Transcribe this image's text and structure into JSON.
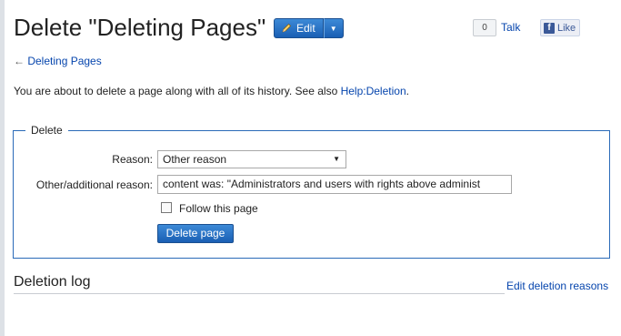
{
  "page": {
    "title": "Delete \"Deleting Pages\"",
    "edit_label": "Edit",
    "talk_count": "0",
    "talk_label": "Talk",
    "like_label": "Like",
    "back_arrow": "←",
    "back_link": "Deleting Pages",
    "intro_text": "You are about to delete a page along with all of its history. See also ",
    "intro_link": "Help:Deletion",
    "intro_end": "."
  },
  "form": {
    "legend": "Delete",
    "reason_label": "Reason:",
    "reason_value": "Other reason",
    "other_label": "Other/additional reason:",
    "other_value": "content was: \"Administrators and users with rights above administ",
    "follow_label": "Follow this page",
    "follow_checked": false,
    "submit_label": "Delete page"
  },
  "log": {
    "heading": "Deletion log",
    "edit_reasons_link": "Edit deletion reasons"
  },
  "icons": {
    "edit": "pencil-icon",
    "caret": "chevron-down-icon",
    "facebook": "facebook-icon"
  },
  "colors": {
    "accent": "#1a5fb4",
    "link": "#0645ad",
    "fieldset_border": "#2a6ab8"
  }
}
